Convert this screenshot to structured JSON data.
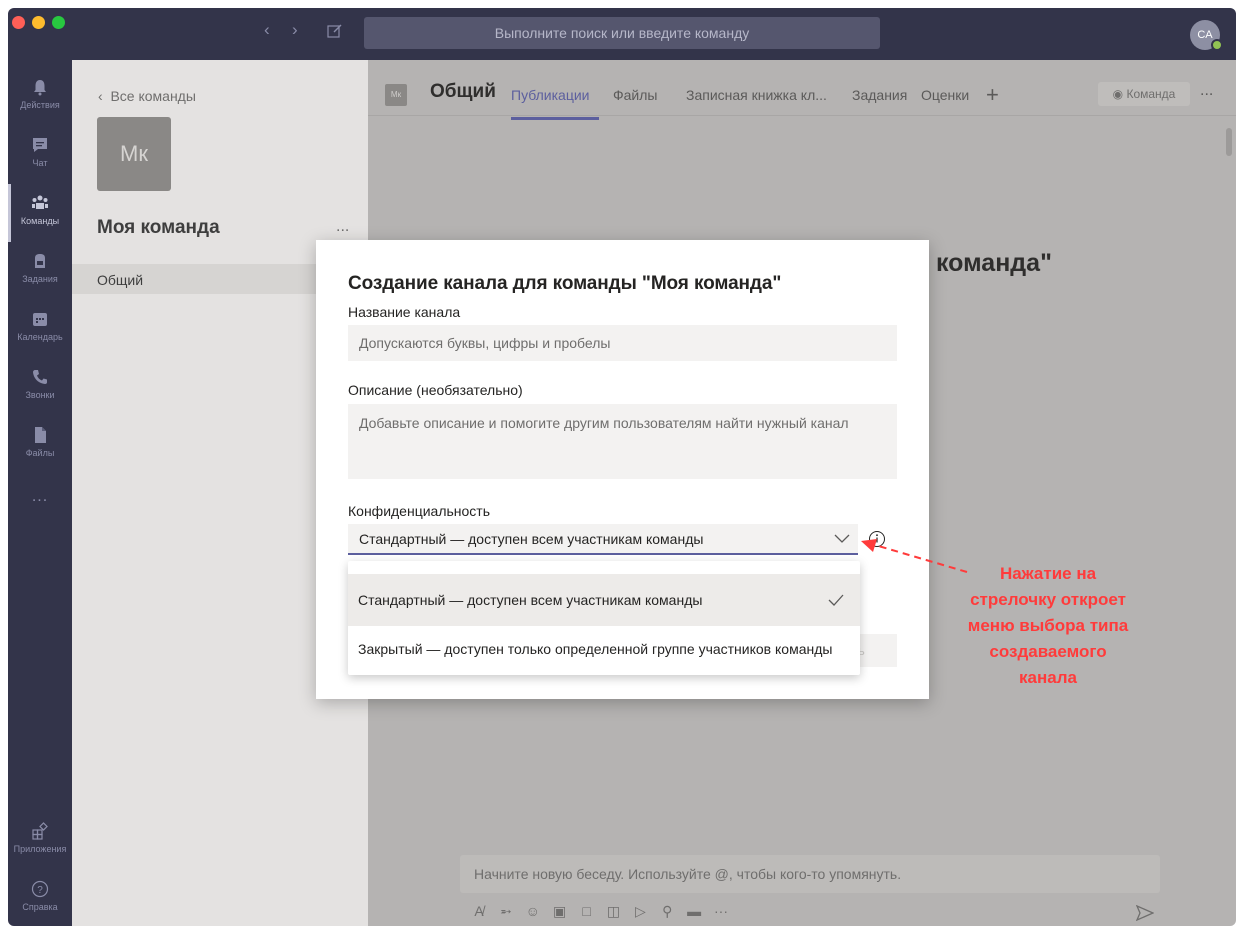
{
  "titlebar": {
    "search_placeholder": "Выполните поиск или введите команду",
    "avatar_initials": "CA"
  },
  "rail": {
    "items": [
      {
        "label": "Действия",
        "icon": "bell-icon"
      },
      {
        "label": "Чат",
        "icon": "chat-icon"
      },
      {
        "label": "Команды",
        "icon": "teams-icon"
      },
      {
        "label": "Задания",
        "icon": "backpack-icon"
      },
      {
        "label": "Календарь",
        "icon": "calendar-icon"
      },
      {
        "label": "Звонки",
        "icon": "phone-icon"
      },
      {
        "label": "Файлы",
        "icon": "file-icon"
      }
    ],
    "more": "...",
    "apps_label": "Приложения",
    "help_label": "Справка"
  },
  "teampanel": {
    "back_label": "Все команды",
    "tile_initials": "Мк",
    "team_name": "Моя команда",
    "more": "...",
    "channel": "Общий"
  },
  "main": {
    "tile_initials": "Мк",
    "channel_title": "Общий",
    "tabs": [
      "Публикации",
      "Файлы",
      "Записная книжка кл...",
      "Задания",
      "Оценки"
    ],
    "team_button": "Команда",
    "more": "...",
    "bg_heading": "команда\"",
    "compose_placeholder": "Начните новую беседу. Используйте @, чтобы кого-то упомянуть."
  },
  "dialog": {
    "title": "Создание канала для команды \"Моя команда\"",
    "name_label": "Название канала",
    "name_placeholder": "Допускаются буквы, цифры и пробелы",
    "desc_label": "Описание (необязательно)",
    "desc_placeholder": "Добавьте описание и помогите другим пользователям найти нужный канал",
    "privacy_label": "Конфиденциальность",
    "privacy_value": "Стандартный — доступен всем участникам команды",
    "hidden_button_fragment": "ть"
  },
  "dropdown": {
    "options": [
      "Стандартный — доступен всем участникам команды",
      "Закрытый — доступен только определенной группе участников команды"
    ],
    "selected_index": 0
  },
  "annotation": {
    "lines": [
      "Нажатие на",
      "стрелочку откроет",
      "меню выбора типа",
      "создаваемого",
      "канала"
    ],
    "color": "#ff3b3b"
  },
  "colors": {
    "rail": "#33344a",
    "accent": "#5c5f9e"
  }
}
